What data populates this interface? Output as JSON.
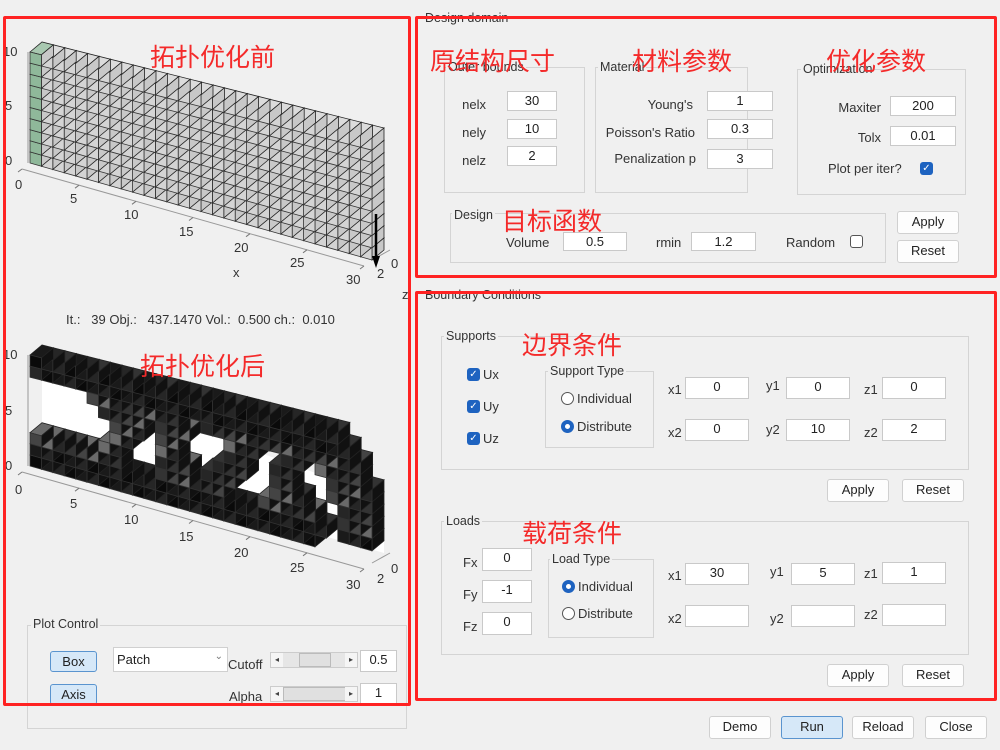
{
  "annotations": {
    "before": "拓扑优化前",
    "after": "拓扑优化后",
    "outer": "原结构尺寸",
    "material": "材料参数",
    "optim": "优化参数",
    "objective": "目标函数",
    "bc": "边界条件",
    "loads": "载荷条件"
  },
  "plot1": {
    "ylabels": [
      "10",
      "5",
      "0"
    ],
    "xlabels": [
      "0",
      "5",
      "10",
      "15",
      "20",
      "25",
      "30"
    ],
    "xlabel": "x",
    "zlabels": [
      "0",
      "2"
    ],
    "zlabel": "z"
  },
  "status": "It.:   39 Obj.:   437.1470 Vol.:  0.500 ch.:  0.010",
  "plot2": {
    "ylabels": [
      "10",
      "5",
      "0"
    ],
    "xlabels": [
      "0",
      "5",
      "10",
      "15",
      "20",
      "25",
      "30"
    ],
    "zlabels": [
      "0",
      "2"
    ]
  },
  "plot_control": {
    "title": "Plot Control",
    "box": "Box",
    "axis": "Axis",
    "mode": "Patch",
    "cutoff_label": "Cutoff",
    "cutoff": "0.5",
    "cutoff_fraction": 0.5,
    "alpha_label": "Alpha",
    "alpha": "1",
    "alpha_fraction": 1
  },
  "design_domain": {
    "title": "Design domain",
    "outer": {
      "title": "Outer bounds",
      "nelx_label": "nelx",
      "nelx": "30",
      "nely_label": "nely",
      "nely": "10",
      "nelz_label": "nelz",
      "nelz": "2"
    },
    "material": {
      "title": "Material",
      "young_label": "Young's",
      "young": "1",
      "poisson_label": "Poisson's Ratio",
      "poisson": "0.3",
      "penal_label": "Penalization p",
      "penal": "3"
    },
    "optimization": {
      "title": "Optimization",
      "maxiter_label": "Maxiter",
      "maxiter": "200",
      "tolx_label": "Tolx",
      "tolx": "0.01",
      "plot_label": "Plot per iter?",
      "plot_checked": true
    },
    "design": {
      "title": "Design",
      "volume_label": "Volume",
      "volume": "0.5",
      "rmin_label": "rmin",
      "rmin": "1.2",
      "random_label": "Random",
      "random_checked": false
    },
    "apply": "Apply",
    "reset": "Reset"
  },
  "boundary": {
    "title": "Boundary Conditions",
    "supports": {
      "title": "Supports",
      "ux": "Ux",
      "uy": "Uy",
      "uz": "Uz",
      "type_title": "Support Type",
      "individual": "Individual",
      "distribute": "Distribute",
      "selected": "Distribute",
      "x1_label": "x1",
      "x1": "0",
      "y1_label": "y1",
      "y1": "0",
      "z1_label": "z1",
      "z1": "0",
      "x2_label": "x2",
      "x2": "0",
      "y2_label": "y2",
      "y2": "10",
      "z2_label": "z2",
      "z2": "2"
    },
    "apply": "Apply",
    "reset": "Reset",
    "loads": {
      "title": "Loads",
      "fx_label": "Fx",
      "fx": "0",
      "fy_label": "Fy",
      "fy": "-1",
      "fz_label": "Fz",
      "fz": "0",
      "type_title": "Load Type",
      "individual": "Individual",
      "distribute": "Distribute",
      "selected": "Individual",
      "x1_label": "x1",
      "x1": "30",
      "y1_label": "y1",
      "y1": "5",
      "z1_label": "z1",
      "z1": "1",
      "x2_label": "x2",
      "x2": "",
      "y2_label": "y2",
      "y2": "",
      "z2_label": "z2",
      "z2": ""
    },
    "apply2": "Apply",
    "reset2": "Reset"
  },
  "footer": {
    "demo": "Demo",
    "run": "Run",
    "reload": "Reload",
    "close": "Close"
  },
  "colors": {
    "annotation": "#f42a2a",
    "accent": "#1e63c0",
    "support_face": "#8fb89a"
  }
}
